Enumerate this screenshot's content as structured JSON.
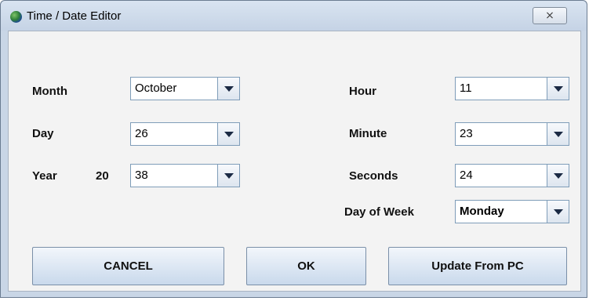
{
  "window": {
    "title": "Time / Date Editor",
    "close_glyph": "⨯"
  },
  "date": {
    "month_label": "Month",
    "month_value": "October",
    "day_label": "Day",
    "day_value": "26",
    "year_label": "Year",
    "year_prefix": "20",
    "year_value": "38"
  },
  "time": {
    "hour_label": "Hour",
    "hour_value": "11",
    "minute_label": "Minute",
    "minute_value": "23",
    "seconds_label": "Seconds",
    "seconds_value": "24",
    "dow_label": "Day of Week",
    "dow_value": "Monday"
  },
  "buttons": {
    "cancel": "CANCEL",
    "ok": "OK",
    "update": "Update From PC"
  },
  "icons": {
    "title_icon": "globe-icon",
    "dropdown_icon": "chevron-down-icon"
  }
}
